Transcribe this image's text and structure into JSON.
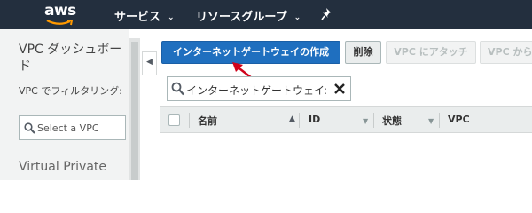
{
  "topbar": {
    "logo_text": "aws",
    "nav": [
      {
        "label": "サービス"
      },
      {
        "label": "リソースグループ"
      }
    ]
  },
  "sidebar": {
    "title": "VPC ダッシュボード",
    "filter_label": "VPC でフィルタリング:",
    "filter_placeholder": "Select a VPC",
    "section": "Virtual Private"
  },
  "toolbar": {
    "create_label": "インターネットゲートウェイの作成",
    "delete_label": "削除",
    "attach_label": "VPC にアタッチ",
    "detach_label": "VPC から"
  },
  "search": {
    "query": "インターネットゲートウェイ: "
  },
  "table": {
    "columns": [
      "名前",
      "ID",
      "状態",
      "VPC"
    ]
  },
  "colors": {
    "header_bg": "#232f3e",
    "primary_button": "#1f6fbf",
    "annotation_arrow": "#d0021b"
  }
}
